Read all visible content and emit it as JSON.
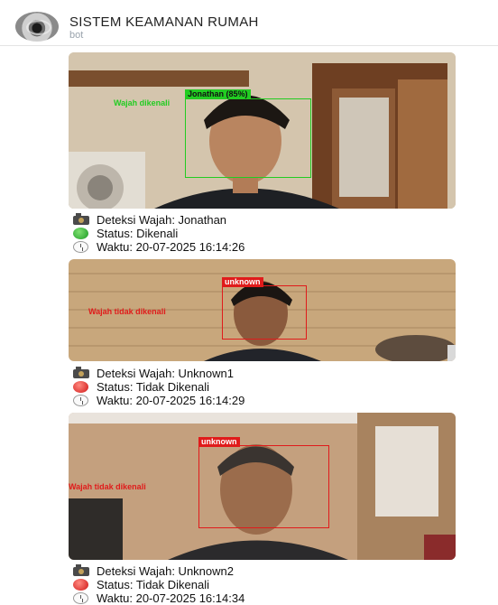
{
  "header": {
    "title": "SISTEM KEAMANAN RUMAH",
    "subtitle": "bot"
  },
  "messages": [
    {
      "annotation": "Wajah dikenali",
      "box_label": "Jonathan (85%)",
      "box_color": "#22cc22",
      "lines": {
        "detection": "Deteksi Wajah: Jonathan",
        "status": "Status: Dikenali",
        "time": "Waktu: 20-07-2025 16:14:26"
      },
      "status_color": "green"
    },
    {
      "annotation": "Wajah tidak dikenali",
      "box_label": "unknown",
      "box_color": "#e01b1b",
      "lines": {
        "detection": "Deteksi Wajah: Unknown1",
        "status": "Status: Tidak Dikenali",
        "time": "Waktu: 20-07-2025 16:14:29"
      },
      "status_color": "red"
    },
    {
      "annotation": "Wajah tidak dikenali",
      "box_label": "unknown",
      "box_color": "#e01b1b",
      "lines": {
        "detection": "Deteksi Wajah: Unknown2",
        "status": "Status: Tidak Dikenali",
        "time": "Waktu: 20-07-2025 16:14:34"
      },
      "status_color": "red"
    }
  ]
}
